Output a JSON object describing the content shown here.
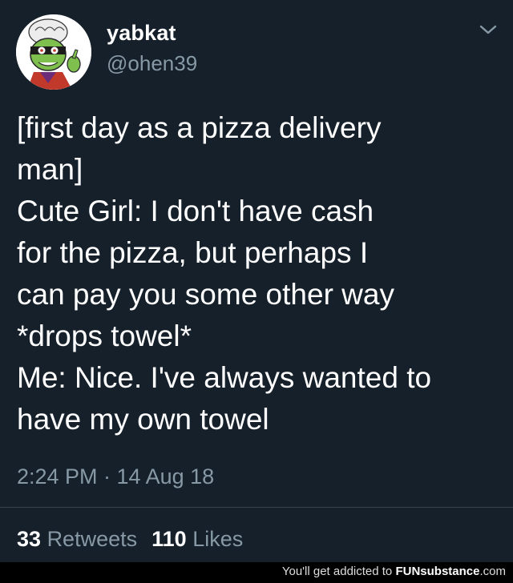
{
  "tweet": {
    "display_name": "yabkat",
    "handle": "@ohen39",
    "body_lines": [
      "[first day as a pizza delivery",
      "man]",
      "Cute Girl: I don't have cash",
      "for the pizza, but perhaps I",
      "can pay you some other way",
      "*drops towel*",
      "Me: Nice. I've always wanted to",
      "have my own towel"
    ],
    "timestamp": "2:24 PM · 14 Aug 18",
    "retweets_count": "33",
    "retweets_label": "Retweets",
    "likes_count": "110",
    "likes_label": "Likes"
  },
  "icons": {
    "menu": "chevron-down-icon",
    "avatar": "avatar"
  },
  "colors": {
    "background": "#15202b",
    "text_primary": "#ffffff",
    "text_secondary": "#8899a6",
    "divider": "#38444d"
  },
  "watermark": {
    "prefix": "You'll get addicted to",
    "brand": "FUNsubstance",
    "suffix": ".com"
  }
}
